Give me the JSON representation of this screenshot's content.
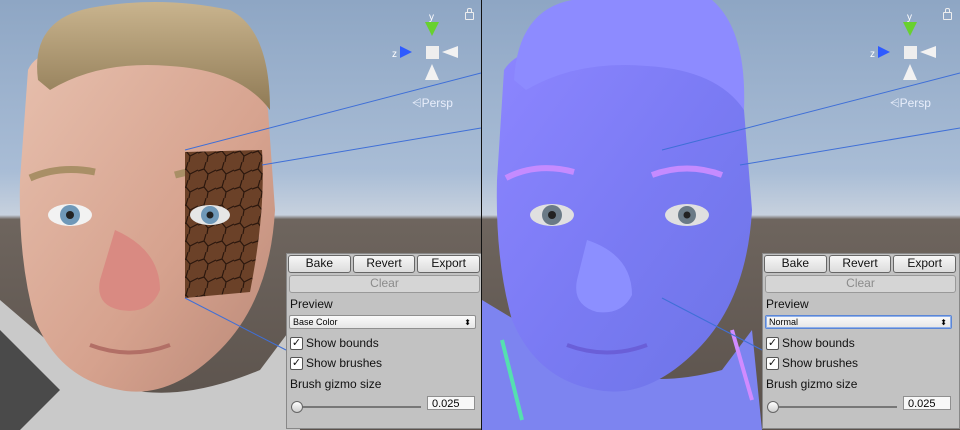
{
  "left_view": {
    "gizmo": {
      "y": "y",
      "z": "z"
    },
    "persp": "Persp",
    "panel": {
      "buttons": [
        "Bake",
        "Revert",
        "Export"
      ],
      "clear": "Clear",
      "preview_label": "Preview",
      "preview_value": "Base Color",
      "show_bounds": "Show bounds",
      "show_brushes": "Show brushes",
      "gizmo_label": "Brush gizmo size",
      "gizmo_value": "0.025"
    }
  },
  "right_view": {
    "gizmo": {
      "y": "y",
      "z": "z"
    },
    "persp": "Persp",
    "panel": {
      "buttons": [
        "Bake",
        "Revert",
        "Export"
      ],
      "clear": "Clear",
      "preview_label": "Preview",
      "preview_value": "Normal",
      "show_bounds": "Show bounds",
      "show_brushes": "Show brushes",
      "gizmo_label": "Brush gizmo size",
      "gizmo_value": "0.025"
    }
  },
  "colors": {
    "normal_map": "#7c7cff",
    "skin": "#d8a38f",
    "gizmo_y": "#68d12f",
    "gizmo_z": "#2e5bff"
  }
}
